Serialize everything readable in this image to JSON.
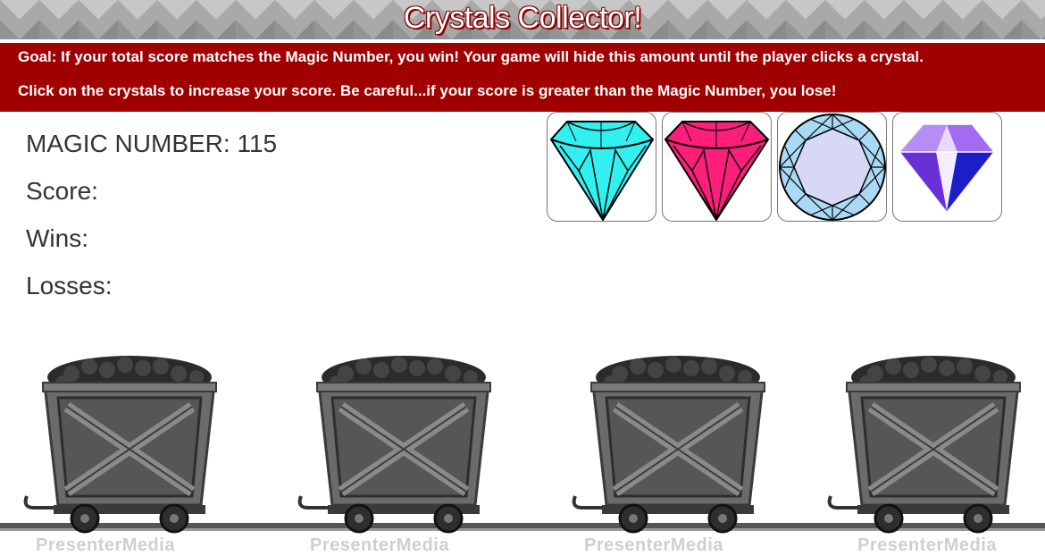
{
  "header": {
    "title": "Crystals Collector!"
  },
  "instructions": {
    "goal": "Goal: If your total score matches the Magic Number, you win! Your game will hide this amount until the player clicks a crystal.",
    "rules": "Click on the crystals to increase your score. Be careful...if your score is greater than the Magic Number, you lose!"
  },
  "stats": {
    "magic_label": "MAGIC NUMBER: ",
    "magic_value": "115",
    "score_label": "Score:",
    "score_value": "",
    "wins_label": "Wins:",
    "wins_value": "",
    "losses_label": "Losses:",
    "losses_value": ""
  },
  "crystals": [
    {
      "name": "cyan-crystal",
      "color": "#33f0f0"
    },
    {
      "name": "pink-crystal",
      "color": "#ff1f7a"
    },
    {
      "name": "lavender-crystal",
      "color": "#c8ccf2"
    },
    {
      "name": "purple-crystal",
      "color": "#8a4bea"
    }
  ],
  "carts": {
    "watermark": "PresenterMedia"
  },
  "colors": {
    "banner": "#a00000",
    "title_shadow": "#8b0000",
    "stat_text": "#333333"
  }
}
